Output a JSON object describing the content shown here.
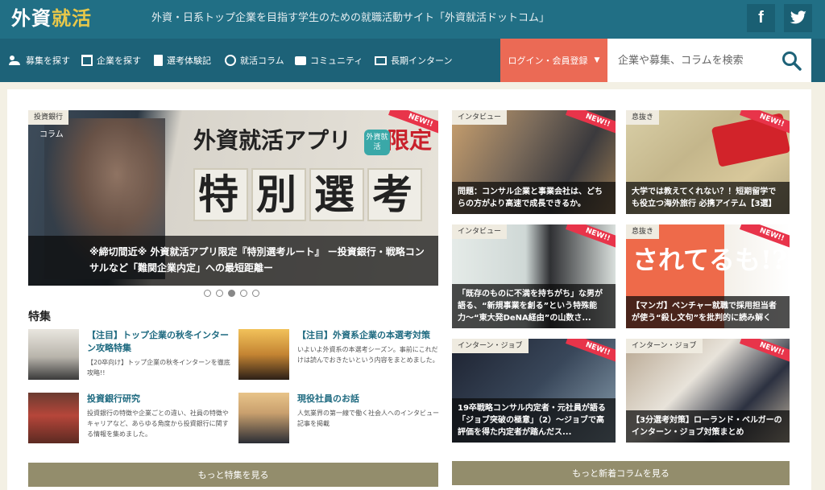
{
  "header": {
    "logo_part1": "外資",
    "logo_part2": "就活",
    "tagline": "外資・日系トップ企業を目指す学生のための就職活動サイト「外資就活ドットコム」",
    "facebook_label": "f",
    "twitter_label": "🐦"
  },
  "nav": {
    "items": [
      {
        "label": "募集を探す",
        "icon": "people-icon"
      },
      {
        "label": "企業を探す",
        "icon": "building-icon"
      },
      {
        "label": "選考体験記",
        "icon": "document-icon"
      },
      {
        "label": "就活コラム",
        "icon": "compass-icon"
      },
      {
        "label": "コミュニティ",
        "icon": "chat-icon"
      },
      {
        "label": "長期インターン",
        "icon": "monitor-icon"
      }
    ],
    "login_label": "ログイン・会員登録",
    "search_placeholder": "企業や募集、コラムを検索"
  },
  "hero": {
    "tag": "投資銀行",
    "new_badge": "NEW!!",
    "image_text_line1": "外資就活アプリ",
    "image_text_red": "限定",
    "app_icon_label": "外資就活",
    "image_text_line2": [
      "特",
      "別",
      "選",
      "考"
    ],
    "caption_tag": "コラム",
    "caption": "※締切間近※ 外資就活アプリ限定『特別選考ルート』 ー投資銀行・戦略コンサルなど「難関企業内定」への最短距離ー"
  },
  "carousel": {
    "count": 5,
    "active": 3
  },
  "features": {
    "title": "特集",
    "items": [
      {
        "title": "【注目】トップ企業の秋冬インターン攻略特集",
        "desc": "【20卒向け】トップ企業の秋冬インターンを徹底攻略!!"
      },
      {
        "title": "【注目】外資系企業の本選考対策",
        "desc": "いよいよ外資系の本選考シーズン。事前にこれだけは読んでおきたいという内容をまとめました。"
      },
      {
        "title": "投資銀行研究",
        "desc": "投資銀行の特徴や企業ごとの違い、社員の特徴やキャリアなど、あらゆる角度から投資銀行に関する情報を集めました。"
      },
      {
        "title": "現役社員のお話",
        "desc": "人気業界の第一線で働く社会人へのインタビュー記事を掲載"
      }
    ],
    "more_label": "もっと特集を見る"
  },
  "columns": {
    "items": [
      {
        "tag": "インタビュー",
        "new": "NEW!!",
        "caption": "問題：コンサル企業と事業会社は、どちらの方がより高速で成長できるか。"
      },
      {
        "tag": "息抜き",
        "new": "NEW!!",
        "caption": "大学では教えてくれない？！短期留学でも役立つ海外旅行 必携アイテム【3選】"
      },
      {
        "tag": "インタビュー",
        "new": "NEW!!",
        "caption": "「既存のものに不満を持ちがち」な男が語る、“新規事業を創る”という特殊能力〜“東大発DeNA経由”の山数さ..."
      },
      {
        "tag": "息抜き",
        "new": "NEW!!",
        "caption": "【マンガ】ベンチャー就職で採用担当者が使う“殺し文句”を批判的に読み解く",
        "image_text": "されてるも!?"
      },
      {
        "tag": "インターン・ジョブ",
        "new": "NEW!!",
        "caption": "19卒戦略コンサル内定者・元社員が語る「ジョブ突破の極意」（2）〜ジョブで高評価を得た内定者が踏んだス..."
      },
      {
        "tag": "インターン・ジョブ",
        "new": "NEW!!",
        "caption": "【3分選考対策】ローランド・ベルガーのインターン・ジョブ対策まとめ"
      }
    ],
    "more_label": "もっと新着コラムを見る"
  },
  "colors": {
    "header_bg": "#216f85",
    "nav_bg": "#1d6278",
    "login_bg": "#eb6a55",
    "more_button_bg": "#938d6c",
    "feature_title": "#1e6a80"
  }
}
